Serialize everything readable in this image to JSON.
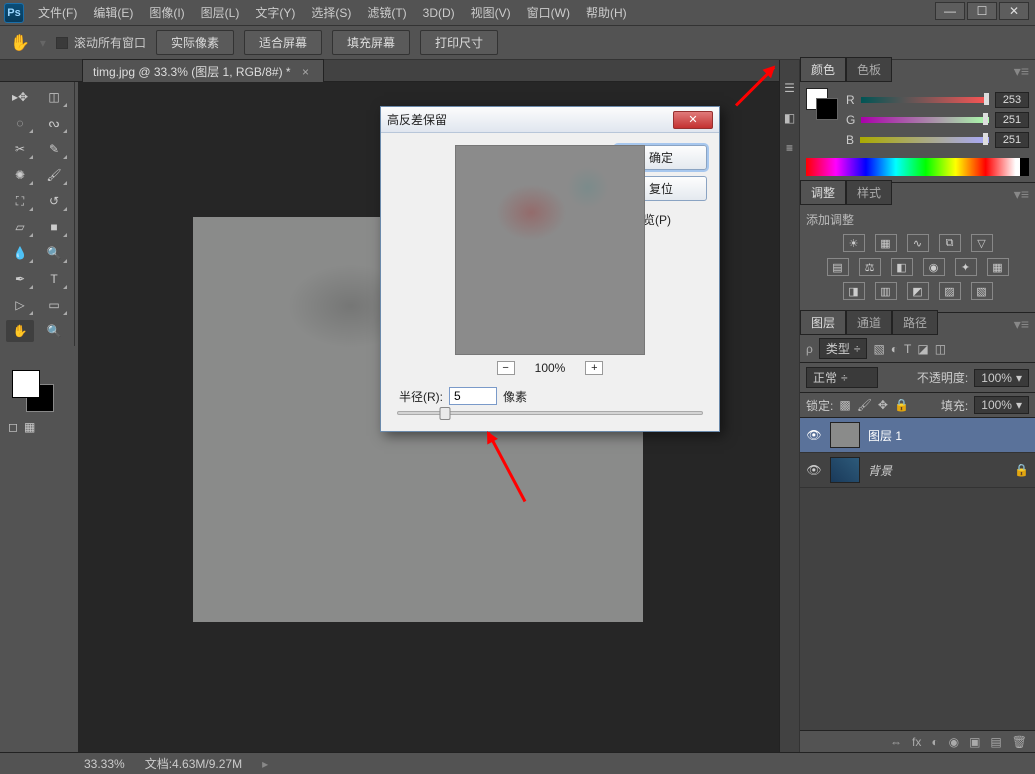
{
  "window_controls": {
    "min": "—",
    "max": "☐",
    "close": "✕"
  },
  "menubar": {
    "items": [
      "文件(F)",
      "编辑(E)",
      "图像(I)",
      "图层(L)",
      "文字(Y)",
      "选择(S)",
      "滤镜(T)",
      "3D(D)",
      "视图(V)",
      "窗口(W)",
      "帮助(H)"
    ]
  },
  "optionsbar": {
    "scroll_all": "滚动所有窗口",
    "buttons": [
      "实际像素",
      "适合屏幕",
      "填充屏幕",
      "打印尺寸"
    ]
  },
  "doctab": {
    "title": "timg.jpg @ 33.3% (图层 1, RGB/8#) *"
  },
  "color_panel": {
    "tab_active": "颜色",
    "tab_inactive": "色板",
    "r": 253,
    "g": 251,
    "b": 251
  },
  "adjust_panel": {
    "tab_active": "调整",
    "tab_inactive": "样式",
    "add_label": "添加调整"
  },
  "layers_panel": {
    "tabs": [
      "图层",
      "通道",
      "路径"
    ],
    "filter_label": "类型",
    "blend_mode": "正常",
    "opacity_label": "不透明度:",
    "opacity_value": "100%",
    "lock_label": "锁定:",
    "fill_label": "填充:",
    "fill_value": "100%",
    "layers": [
      {
        "name": "图层 1",
        "locked": false
      },
      {
        "name": "背景",
        "locked": true
      }
    ]
  },
  "statusbar": {
    "zoom": "33.33%",
    "docinfo": "文档:4.63M/9.27M"
  },
  "dialog": {
    "title": "高反差保留",
    "ok": "确定",
    "reset": "复位",
    "preview": "预览(P)",
    "zoom": "100%",
    "radius_label": "半径(R):",
    "radius_value": "5",
    "unit": "像素"
  }
}
